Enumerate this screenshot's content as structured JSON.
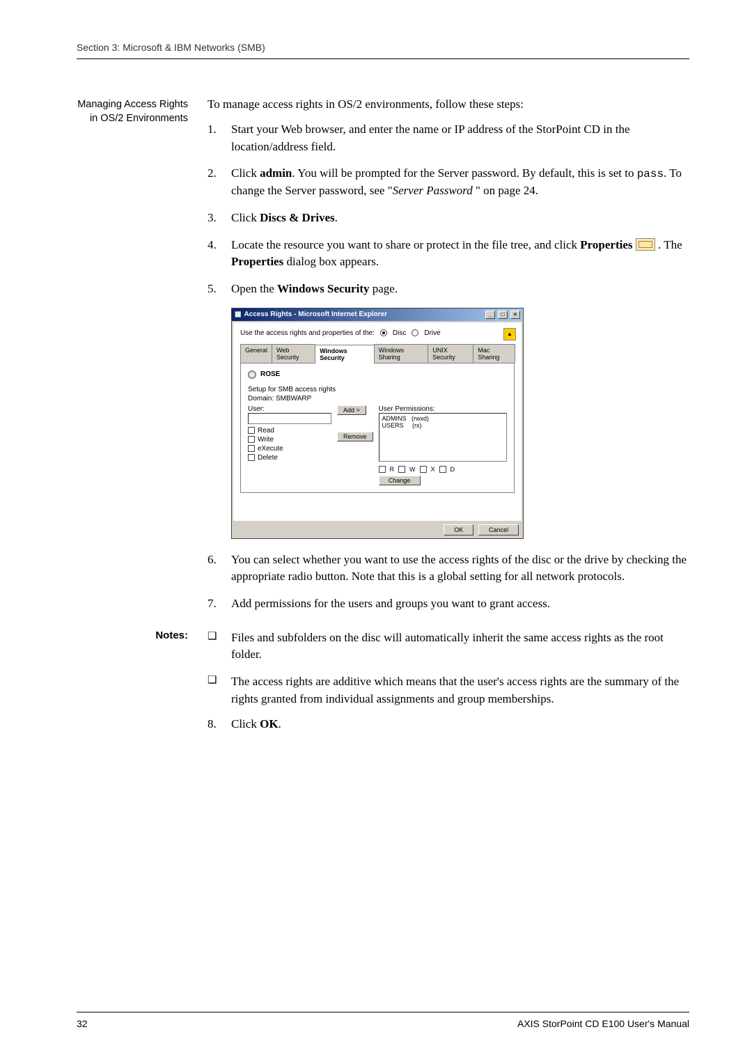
{
  "header": {
    "section": "Section 3: Microsoft & IBM Networks (SMB)"
  },
  "sidebar": {
    "heading": "Managing Access Rights in OS/2 Environments"
  },
  "intro": "To manage access rights in OS/2 environments, follow these steps:",
  "steps": {
    "s1": "Start your Web browser, and enter the name or IP address of the StorPoint CD in the location/address field.",
    "s2a": "Click ",
    "s2bold": "admin",
    "s2b": ". You will be prompted for the Server password. By default, this is set to ",
    "s2pass": "pass",
    "s2c": ". To change the Server password, see \"",
    "s2italic": "Server Password",
    "s2d": " \" on page 24.",
    "s3a": "Click ",
    "s3bold": "Discs & Drives",
    "s3b": ".",
    "s4a": "Locate the resource you want to share or protect in the file tree, and click ",
    "s4bold1": "Properties",
    "s4b": " . The ",
    "s4bold2": "Properties",
    "s4c": " dialog box appears.",
    "s5a": "Open the ",
    "s5bold": "Windows Security",
    "s5b": " page.",
    "s6": "You can select whether you want to use the access rights of the disc or the drive by checking the appropriate radio button. Note that this is a global setting for all network protocols.",
    "s7": "Add permissions for the users and groups you want to grant access."
  },
  "dialog": {
    "title": "Access Rights - Microsoft Internet Explorer",
    "useLabel": "Use the access rights and properties of the:",
    "radioDisc": "Disc",
    "radioDrive": "Drive",
    "tabs": [
      "General",
      "Web Security",
      "Windows Security",
      "Windows Sharing",
      "UNIX Security",
      "Mac Sharing"
    ],
    "activeTab": 2,
    "discName": "ROSE",
    "setupLabel": "Setup for SMB access rights",
    "domainLabel": "Domain: SMBWARP",
    "userLabel": "User:",
    "permLabel": "User Permissions:",
    "checks": [
      "Read",
      "Write",
      "eXecute",
      "Delete"
    ],
    "addBtn": "Add >",
    "removeBtn": "Remove",
    "permList": "ADMINS   (rwxd)\nUSERS     (rx)",
    "miniChecks": [
      "R",
      "W",
      "X",
      "D"
    ],
    "changeBtn": "Change",
    "okBtn": "OK",
    "cancelBtn": "Cancel"
  },
  "notesLabel": "Notes:",
  "notes": {
    "n1": "Files and subfolders on the disc will automatically inherit the same access rights as the root folder.",
    "n2": "The access rights are additive which means that the user's access rights are the summary of the rights granted from individual assignments and group memberships."
  },
  "step8a": "Click ",
  "step8bold": "OK",
  "step8b": ".",
  "footer": {
    "page": "32",
    "manual": "AXIS StorPoint CD E100 User's Manual"
  }
}
